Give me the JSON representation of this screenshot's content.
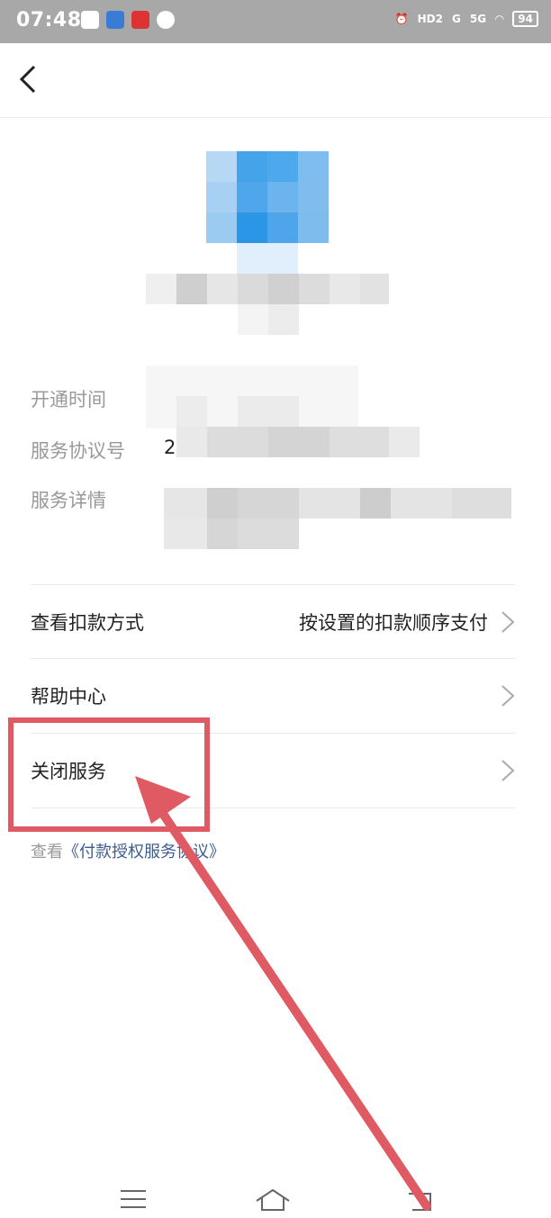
{
  "status_bar": {
    "time": "07:48",
    "hd_label": "HD2",
    "signal_1": "G",
    "signal_2": "5G",
    "battery": "94"
  },
  "header": {
    "back_icon": "chevron-left-icon"
  },
  "info": {
    "open_time_label": "开通时间",
    "agreement_no_label": "服务协议号",
    "agreement_no_partial": "2",
    "details_label": "服务详情"
  },
  "menu": {
    "payment_method_label": "查看扣款方式",
    "payment_method_value": "按设置的扣款顺序支付",
    "help_label": "帮助中心",
    "close_label": "关闭服务"
  },
  "agreement": {
    "prefix": "查看",
    "link": "《付款授权服务协议》"
  },
  "colors": {
    "annotation": "#e05a63",
    "link": "#3d5d8c",
    "status_bar": "#a8a8a8"
  }
}
